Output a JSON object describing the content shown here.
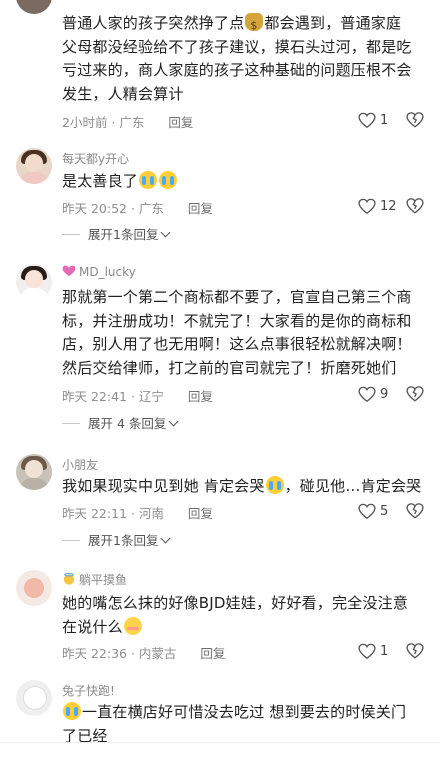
{
  "comments": [
    {
      "username": "",
      "text_parts": [
        "普通人家的孩子突然挣了点",
        "都会遇到，普通家庭父母都没经验给不了孩子建议，摸石头过河，都是吃亏过来的，商人家庭的孩子这种基础的问题压根不会发生，人精会算计"
      ],
      "time": "2小时前 · 广东",
      "reply_label": "回复",
      "likes": "1"
    },
    {
      "username": "每天都y开心",
      "text": "是太善良了",
      "time": "昨天 20:52 · 广东",
      "reply_label": "回复",
      "likes": "12",
      "expand_label": "展开1条回复"
    },
    {
      "username": "MD_lucky",
      "text": "那就第一个第二个商标都不要了，官宣自己第三个商标，并注册成功！不就完了！大家看的是你的商标和店，别人用了也无用啊！这么点事很轻松就解决啊！然后交给律师，打之前的官司就完了！折磨死她们",
      "time": "昨天 22:41 · 辽宁",
      "reply_label": "回复",
      "likes": "9",
      "expand_label": "展开 4 条回复"
    },
    {
      "username": "小朋友",
      "text_parts": [
        "我如果现实中见到她 肯定会哭",
        "，碰见他…肯定会哭"
      ],
      "time": "昨天 22:11 · 河南",
      "reply_label": "回复",
      "likes": "5",
      "expand_label": "展开1条回复"
    },
    {
      "username": "躺平摸鱼",
      "text": "她的嘴怎么抹的好像BJD娃娃，好好看，完全没注意在说什么",
      "time": "昨天 22:36 · 内蒙古",
      "reply_label": "回复",
      "likes": "1"
    },
    {
      "username": "兔子快跑!",
      "text": "一直在横店好可惜没去吃过 想到要去的时侯关门了已经"
    }
  ],
  "colors": {
    "meta_gray": "#8f8f8f",
    "username_gray": "#8a8a8a",
    "badge_pink": "#e86ab6",
    "badge_yellow": "#f5c542"
  }
}
